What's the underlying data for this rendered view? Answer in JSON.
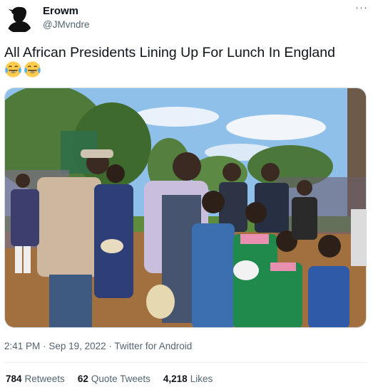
{
  "author": {
    "display_name": "Erowm",
    "handle": "@JMvndre",
    "avatar_icon": "silhouette-avatar-icon"
  },
  "more_icon": "more-options-icon",
  "tweet": {
    "text": "All African Presidents Lining Up For Lunch In England",
    "emojis": [
      "face-with-tears-of-joy",
      "face-with-tears-of-joy"
    ]
  },
  "meta": {
    "time": "2:41 PM",
    "separator1": "·",
    "date": "Sep 19, 2022",
    "separator2": "·",
    "source": "Twitter for Android"
  },
  "stats": {
    "retweets": {
      "count": "784",
      "label": "Retweets"
    },
    "quotes": {
      "count": "62",
      "label": "Quote Tweets"
    },
    "likes": {
      "count": "4,218",
      "label": "Likes"
    }
  },
  "colors": {
    "text": "#0f1419",
    "secondary": "#536471",
    "divider": "#eff3f4"
  }
}
